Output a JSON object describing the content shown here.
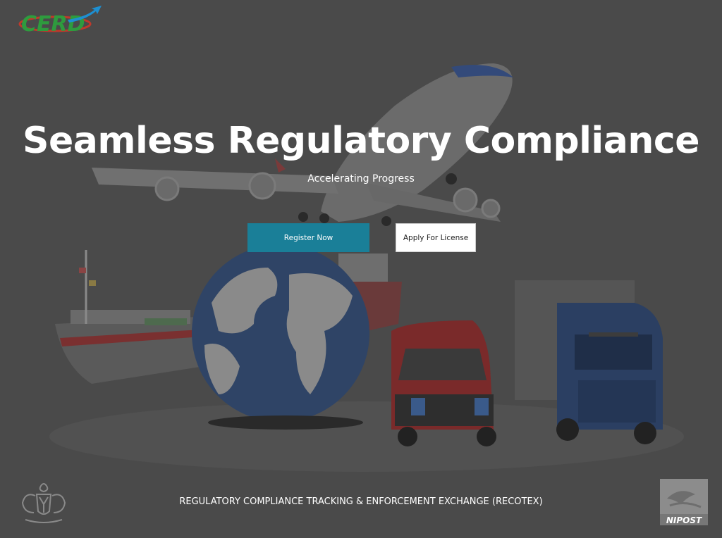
{
  "brand": {
    "logo_text": "CERD",
    "logo_icon": "arrow-swoosh-icon"
  },
  "hero": {
    "title": "Seamless Regulatory Compliance",
    "subtitle": "Accelerating Progress",
    "background_image": "transport-globe-image"
  },
  "actions": {
    "register_label": "Register Now",
    "apply_label": "Apply For License"
  },
  "footer": {
    "text": "REGULATORY COMPLIANCE TRACKING & ENFORCEMENT EXCHANGE (RECOTEX)",
    "left_emblem": "coat-of-arms-icon",
    "right_logo_text": "NIPOST",
    "right_logo": "nipost-logo-icon"
  },
  "colors": {
    "background": "#4a4a4a",
    "primary_button": "#1a7f98",
    "secondary_button": "#ffffff",
    "text": "#ffffff"
  }
}
